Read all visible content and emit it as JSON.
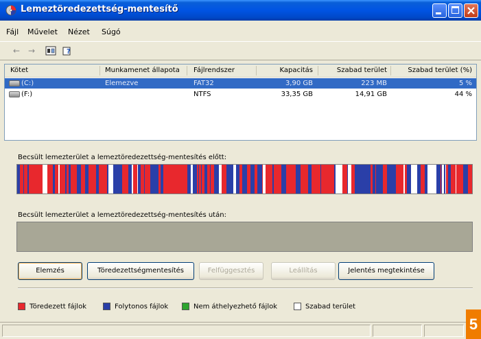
{
  "window": {
    "title": "Lemeztöredezettség-mentesítő"
  },
  "menu": [
    "Fájl",
    "Művelet",
    "Nézet",
    "Súgó"
  ],
  "toolbar": {
    "icons": [
      "back-arrow-icon",
      "forward-arrow-icon",
      "properties-icon",
      "help-icon"
    ]
  },
  "volumes": {
    "columns": [
      "Kötet",
      "Munkamenet állapota",
      "Fájlrendszer",
      "Kapacitás",
      "Szabad terület",
      "Szabad terület (%)"
    ],
    "rows": [
      {
        "volume": "(C:)",
        "status": "Elemezve",
        "fs": "FAT32",
        "capacity": "3,90 GB",
        "free": "223 MB",
        "free_pct": "5 %",
        "selected": true
      },
      {
        "volume": "(F:)",
        "status": "",
        "fs": "NTFS",
        "capacity": "33,35 GB",
        "free": "14,91 GB",
        "free_pct": "44 %",
        "selected": false
      }
    ]
  },
  "before": {
    "label": "Becsült lemezterület a lemeztöredezettség-mentesítés előtt:"
  },
  "after": {
    "label": "Becsült lemezterület a lemeztöredezettség-mentesítés után:"
  },
  "buttons": {
    "analyze": "Elemzés",
    "defrag": "Töredezettségmentesítés",
    "pause": "Felfüggesztés",
    "stop": "Leállítás",
    "report": "Jelentés megtekintése"
  },
  "legend": {
    "fragmented": "Töredezett fájlok",
    "contiguous": "Folytonos fájlok",
    "unmovable": "Nem áthelyezhető fájlok",
    "free": "Szabad terület"
  },
  "colors": {
    "fragmented": "#e8282d",
    "contiguous": "#2a3fa8",
    "unmovable": "#2ea52e",
    "free": "#ffffff"
  },
  "badge": "5"
}
